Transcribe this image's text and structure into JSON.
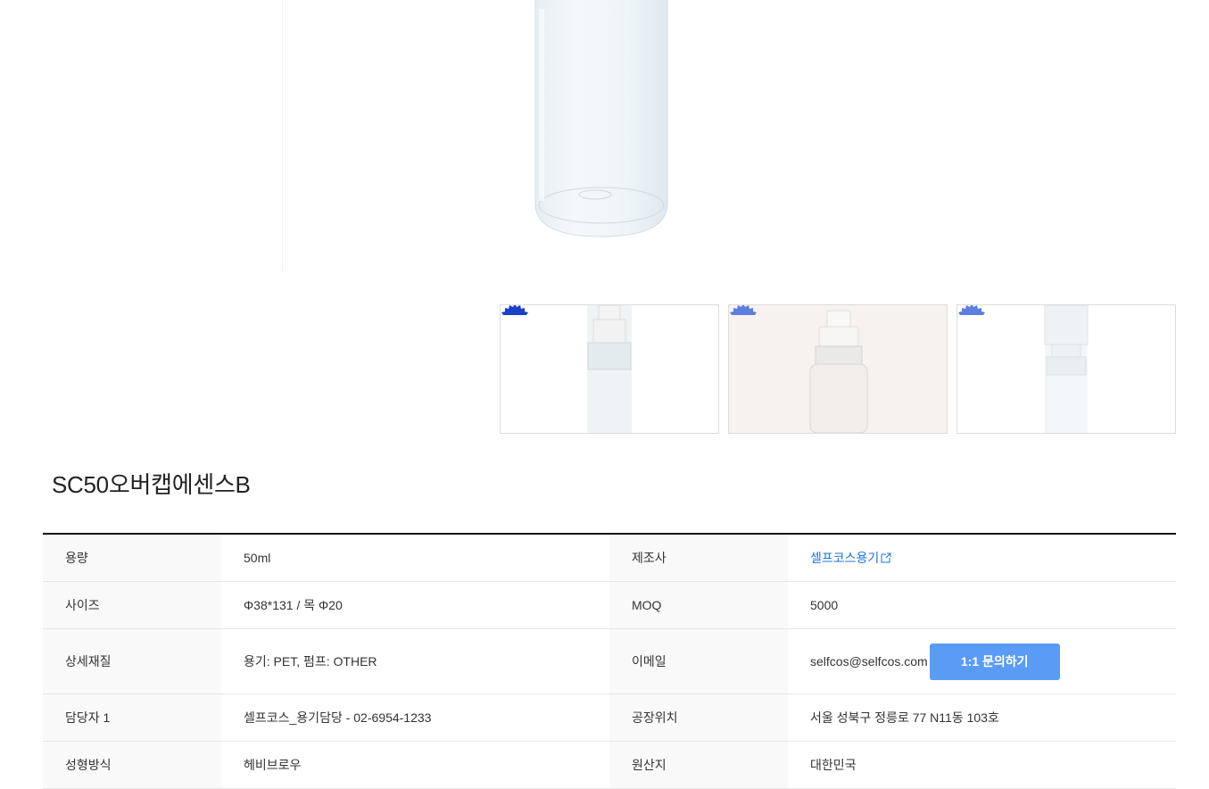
{
  "product": {
    "title": "SC50오버캡에센스B"
  },
  "gallery": {
    "thumbnails": [
      {
        "name": "thumbnail-1"
      },
      {
        "name": "thumbnail-2"
      },
      {
        "name": "thumbnail-3"
      }
    ]
  },
  "specs": {
    "rows": [
      {
        "label": "용량",
        "value": "50ml",
        "label2": "제조사",
        "value2": "셀프코스용기"
      },
      {
        "label": "사이즈",
        "value": "Φ38*131 / 목 Φ20",
        "label2": "MOQ",
        "value2": "5000"
      },
      {
        "label": "상세재질",
        "value": "용기: PET, 펌프: OTHER",
        "label2": "이메일",
        "value2": "selfcos@selfcos.com"
      },
      {
        "label": "담당자 1",
        "value": "셀프코스_용기담당 - 02-6954-1233",
        "label2": "공장위치",
        "value2": "서울 성북구 정릉로 77 N11동 103호"
      },
      {
        "label": "성형방식",
        "value": "헤비브로우",
        "label2": "원산지",
        "value2": "대한민국"
      }
    ],
    "inquiry_button": "1:1 문의하기"
  },
  "colors": {
    "accent": "#5a9bf6",
    "link": "#1a73d9",
    "seal": "#1b3fc7"
  }
}
